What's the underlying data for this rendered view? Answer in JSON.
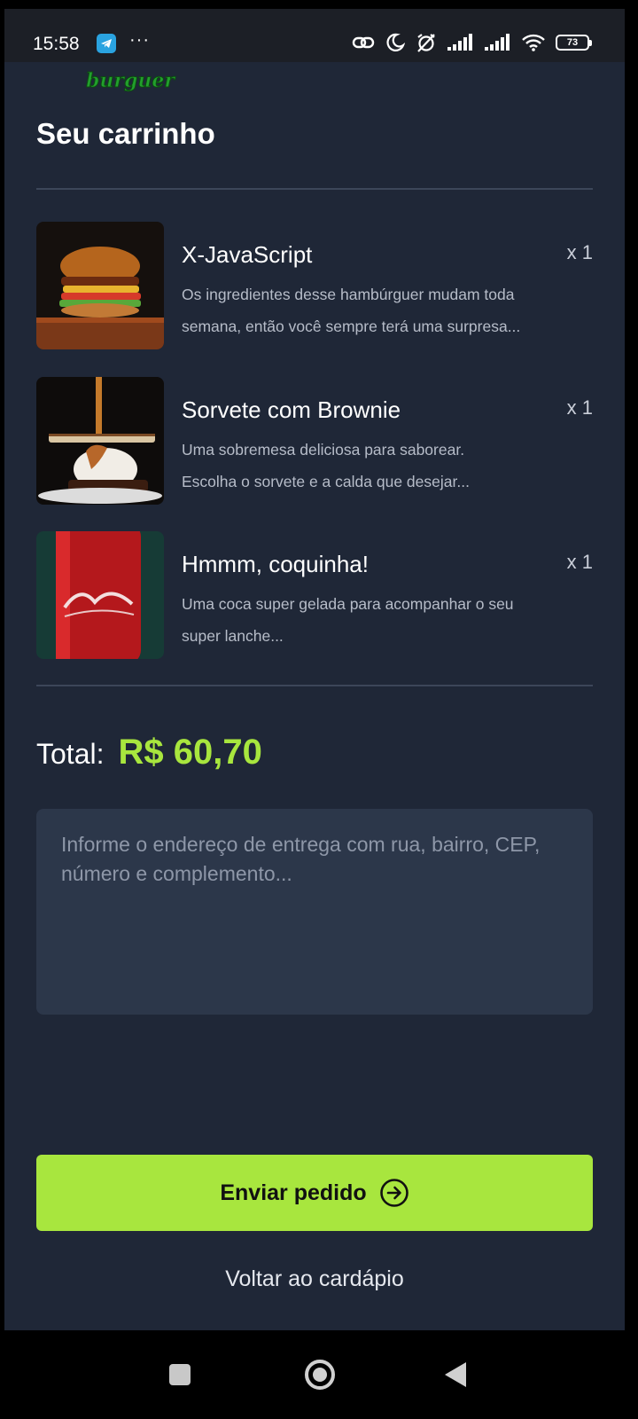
{
  "status_bar": {
    "time": "15:58",
    "more": "···",
    "battery": "73"
  },
  "logo": {
    "text": "burguer"
  },
  "title": "Seu carrinho",
  "items": [
    {
      "name": "X-JavaScript",
      "qty": "x 1",
      "description": "Os ingredientes desse hambúrguer mudam toda\nsemana, então você sempre terá uma surpresa...",
      "image": "burger-photo"
    },
    {
      "name": "Sorvete com Brownie",
      "qty": "x 1",
      "description": "Uma sobremesa deliciosa para saborear.\nEscolha o sorvete e a calda que desejar...",
      "image": "dessert-photo"
    },
    {
      "name": "Hmmm, coquinha!",
      "qty": "x 1",
      "description": "Uma coca super gelada para acompanhar o seu\nsuper lanche...",
      "image": "coca-cola-can-photo"
    }
  ],
  "total": {
    "label": "Total:",
    "value": "R$ 60,70"
  },
  "address": {
    "placeholder": "Informe o endereço de entrega com rua, bairro, CEP, número e complemento...",
    "value": ""
  },
  "actions": {
    "send_label": "Enviar pedido",
    "back_label": "Voltar ao cardápio"
  },
  "colors": {
    "background": "#1f2737",
    "accent": "#a8e63e",
    "input_bg": "#2c374a"
  }
}
